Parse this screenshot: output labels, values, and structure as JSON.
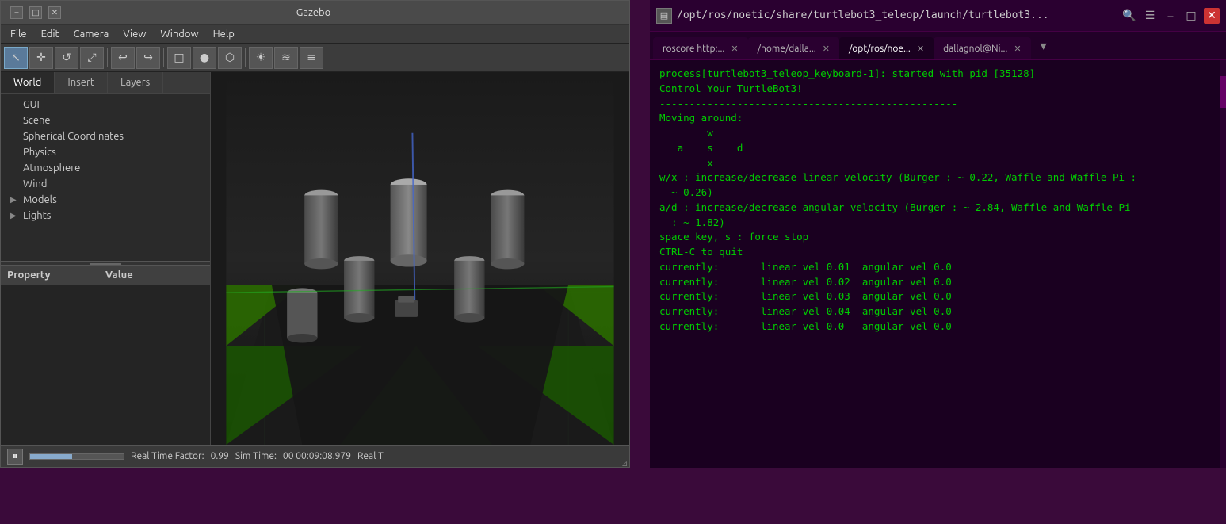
{
  "gazebo": {
    "title": "Gazebo",
    "window_buttons": {
      "minimize": "–",
      "maximize": "□",
      "close": "✕"
    },
    "menubar": {
      "items": [
        "File",
        "Edit",
        "Camera",
        "View",
        "Window",
        "Help"
      ]
    },
    "toolbar": {
      "buttons": [
        "↖",
        "✛",
        "↺",
        "⤢",
        "↩",
        "↪",
        "□",
        "●",
        "⬡",
        "☀",
        "≋",
        "≡"
      ]
    },
    "panel": {
      "tabs": [
        "World",
        "Insert",
        "Layers"
      ],
      "active_tab": "World",
      "tree_items": [
        {
          "label": "GUI",
          "indent": 0,
          "has_arrow": false
        },
        {
          "label": "Scene",
          "indent": 0,
          "has_arrow": false
        },
        {
          "label": "Spherical Coordinates",
          "indent": 0,
          "has_arrow": false
        },
        {
          "label": "Physics",
          "indent": 0,
          "has_arrow": false
        },
        {
          "label": "Atmosphere",
          "indent": 0,
          "has_arrow": false
        },
        {
          "label": "Wind",
          "indent": 0,
          "has_arrow": false
        },
        {
          "label": "Models",
          "indent": 0,
          "has_arrow": true
        },
        {
          "label": "Lights",
          "indent": 0,
          "has_arrow": true
        }
      ],
      "property_cols": {
        "property": "Property",
        "value": "Value"
      }
    },
    "statusbar": {
      "pause_icon": "⏸",
      "real_time_factor_label": "Real Time Factor:",
      "real_time_factor_value": "0.99",
      "sim_time_label": "Sim Time:",
      "sim_time_value": "00 00:09:08.979",
      "real_t_label": "Real T"
    }
  },
  "terminal": {
    "titlebar": {
      "icon": "▤",
      "path": "/opt/ros/noetic/share/turtlebot3_teleop/launch/turtlebot3...",
      "search_icon": "🔍",
      "menu_icon": "☰",
      "minimize_icon": "–",
      "maximize_icon": "□",
      "close_icon": "✕"
    },
    "tabs": [
      {
        "label": "roscore http:...",
        "active": false,
        "has_close": true
      },
      {
        "label": "/home/dalla...",
        "active": false,
        "has_close": true
      },
      {
        "label": "/opt/ros/noe...",
        "active": true,
        "has_close": true
      },
      {
        "label": "dallagnol@Ni...",
        "active": false,
        "has_close": true
      }
    ],
    "lines": [
      "process[turtlebot3_teleop_keyboard-1]: started with pid [35128]",
      "",
      "Control Your TurtleBot3!",
      "--------------------------------------------------",
      "Moving around:",
      "        w",
      "   a    s    d",
      "        x",
      "",
      "w/x : increase/decrease linear velocity (Burger : ~ 0.22, Waffle and Waffle Pi :",
      "  ~ 0.26)",
      "a/d : increase/decrease angular velocity (Burger : ~ 2.84, Waffle and Waffle Pi",
      "  : ~ 1.82)",
      "",
      "space key, s : force stop",
      "",
      "CTRL-C to quit",
      "",
      "currently:       linear vel 0.01  angular vel 0.0",
      "currently:       linear vel 0.02  angular vel 0.0",
      "currently:       linear vel 0.03  angular vel 0.0",
      "currently:       linear vel 0.04  angular vel 0.0",
      "currently:       linear vel 0.0   angular vel 0.0"
    ]
  }
}
